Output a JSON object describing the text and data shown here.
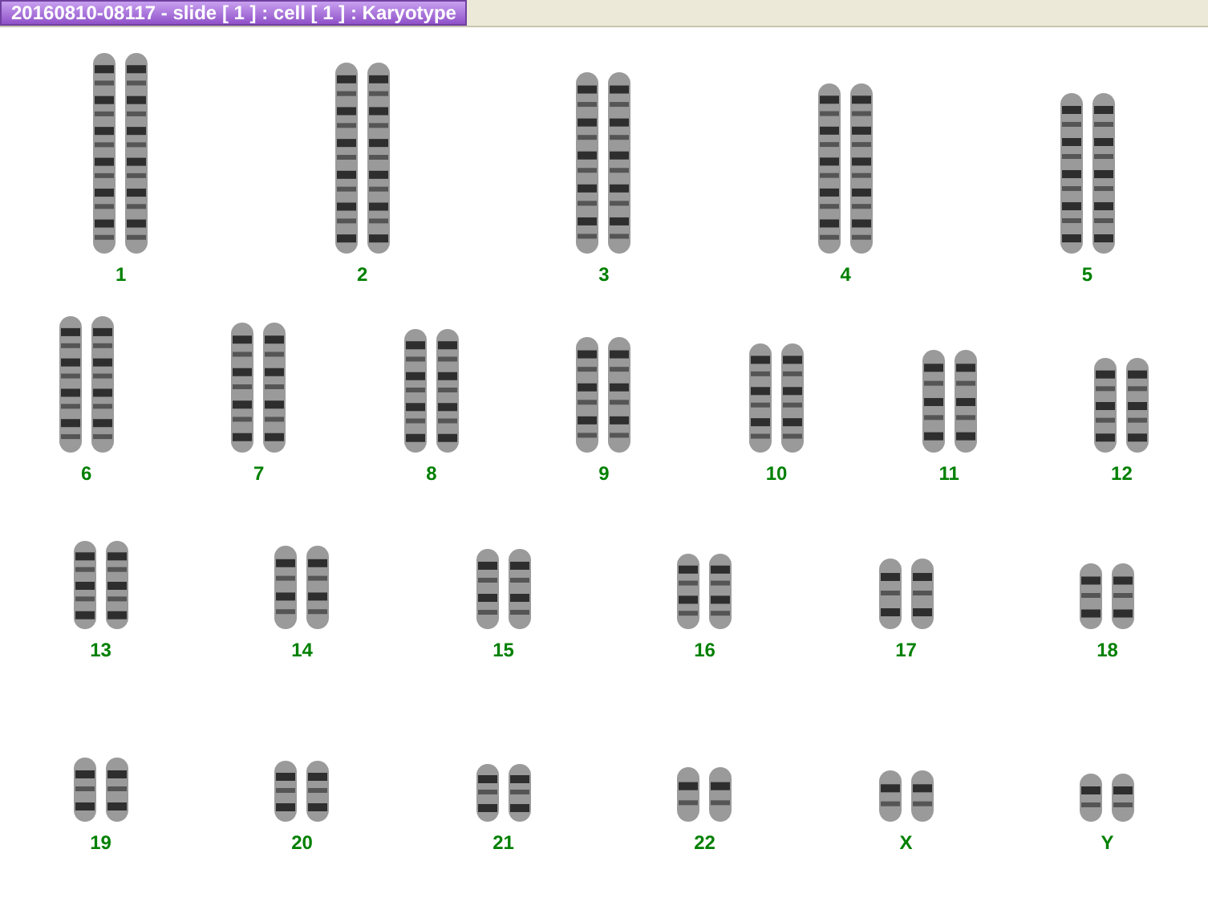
{
  "window": {
    "title": "20160810-08117 - slide [ 1 ] : cell [ 1 ] : Karyotype"
  },
  "karyotype": {
    "rows": [
      {
        "chromosomes": [
          "1",
          "2",
          "3",
          "4",
          "5"
        ]
      },
      {
        "chromosomes": [
          "6",
          "7",
          "8",
          "9",
          "10",
          "11",
          "12"
        ]
      },
      {
        "chromosomes": [
          "13",
          "14",
          "15",
          "16",
          "17",
          "18"
        ]
      },
      {
        "chromosomes": [
          "19",
          "20",
          "21",
          "22",
          "X",
          "Y"
        ]
      }
    ]
  }
}
